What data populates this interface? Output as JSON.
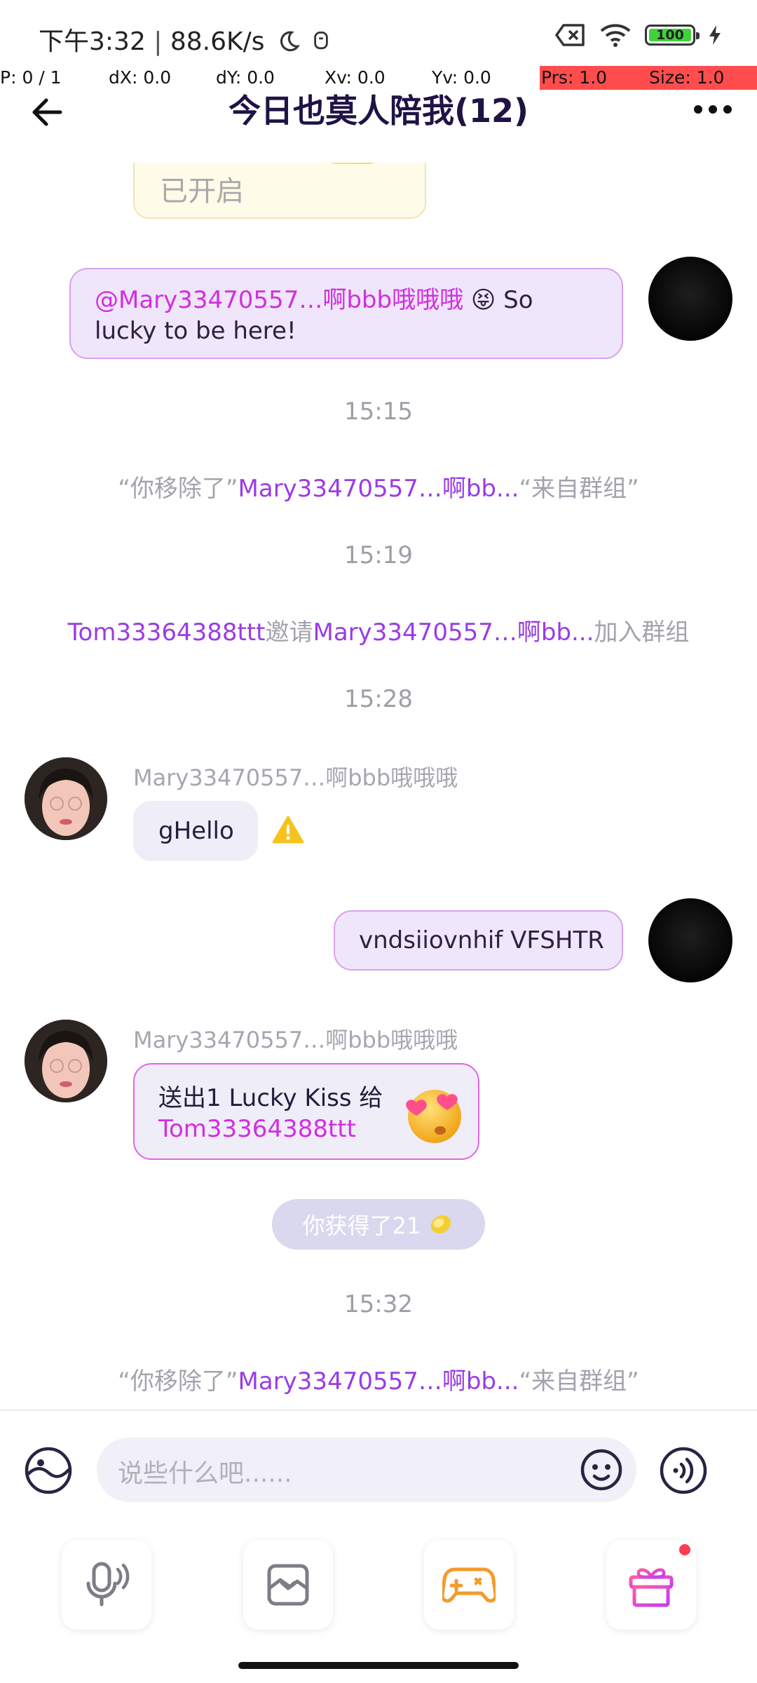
{
  "status_bar": {
    "time": "下午3:32",
    "speed": "88.6K/s",
    "battery": "100"
  },
  "debug_overlay": {
    "p": "P: 0 / 1",
    "dx": "dX: 0.0",
    "dy": "dY: 0.0",
    "xv": "Xv: 0.0",
    "yv": "Yv: 0.0",
    "prs": "Prs: 1.0",
    "size": "Size: 1.0"
  },
  "header": {
    "title": "今日也莫人陪我(12)"
  },
  "chat": {
    "partial_card_text": "已开启",
    "msg1_mention": "@Mary33470557…啊bbb哦哦哦",
    "msg1_emoji": "😝",
    "msg1_text_a": " So",
    "msg1_text_b": "lucky to be here!",
    "time1": "15:15",
    "sys1_pre": "“你移除了”",
    "sys1_name": "Mary33470557…啊bb...",
    "sys1_post": "“来自群组”",
    "time2": "15:19",
    "sys2_inviter": "Tom33364388ttt",
    "sys2_mid": "邀请",
    "sys2_invitee": "Mary33470557…啊bb...",
    "sys2_post": "加入群组",
    "time3": "15:28",
    "msg2_nick": "Mary33470557…啊bbb哦哦哦",
    "msg2_text": "gHello",
    "msg3_text": "vndsiiovnhif VFSHTR",
    "msg4_nick": "Mary33470557…啊bbb哦哦哦",
    "msg4_line1": "送出1 Lucky Kiss 给",
    "msg4_target": "Tom33364388ttt",
    "reward_text": "你获得了21",
    "time4": "15:32",
    "sys3_pre": "“你移除了”",
    "sys3_name": "Mary33470557…啊bb...",
    "sys3_post": "“来自群组”"
  },
  "input": {
    "placeholder": "说些什么吧......"
  },
  "toolbar": {
    "icons": [
      "voice-room-icon",
      "album-icon",
      "game-icon",
      "gift-icon"
    ]
  },
  "colors": {
    "accent_purple": "#9a3be6",
    "mention_pink": "#d12ee0",
    "bubble_self": "#efe6fb",
    "bubble_other": "#efedf7"
  }
}
